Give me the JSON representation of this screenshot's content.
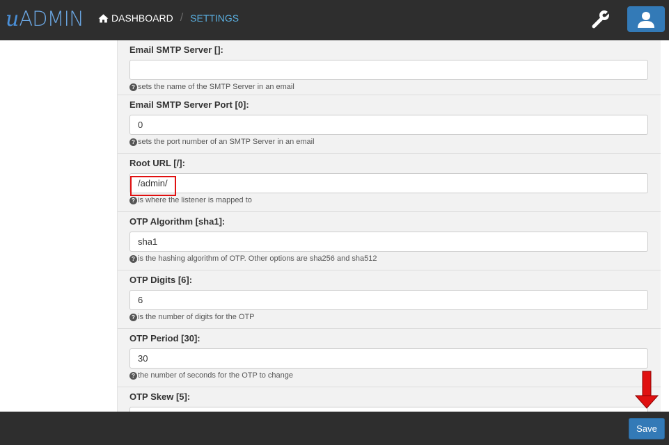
{
  "brand": {
    "prefix": "u",
    "name": "ADMIN"
  },
  "nav": {
    "dashboard_label": "DASHBOARD",
    "separator": "/",
    "settings_label": "SETTINGS"
  },
  "settings": [
    {
      "label": "Email SMTP Server []:",
      "value": "",
      "help": "sets the name of the SMTP Server in an email"
    },
    {
      "label": "Email SMTP Server Port [0]:",
      "value": "0",
      "help": "sets the port number of an SMTP Server in an email"
    },
    {
      "label": "Root URL [/]:",
      "value": "/admin/",
      "help": "is where the listener is mapped to"
    },
    {
      "label": "OTP Algorithm [sha1]:",
      "value": "sha1",
      "help": "is the hashing algorithm of OTP. Other options are sha256 and sha512"
    },
    {
      "label": "OTP Digits [6]:",
      "value": "6",
      "help": "is the number of digits for the OTP"
    },
    {
      "label": "OTP Period [30]:",
      "value": "30",
      "help": "the number of seconds for the OTP to change"
    },
    {
      "label": "OTP Skew [5]:",
      "value": "",
      "help": ""
    }
  ],
  "footer": {
    "save_label": "Save"
  },
  "colors": {
    "navbar": "#2e2e2e",
    "accent": "#337ab7",
    "highlight": "#e01010",
    "arrow": "#e01010"
  },
  "icons": {
    "home": "home-icon",
    "settings": "wrench-icon",
    "user": "user-icon",
    "help": "question-circle-icon"
  }
}
